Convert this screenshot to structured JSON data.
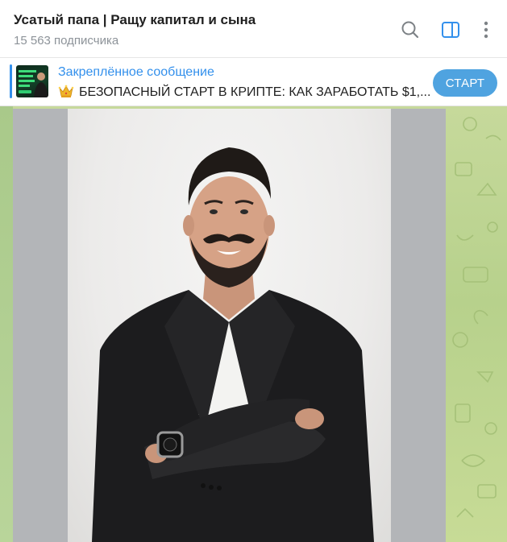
{
  "header": {
    "title": "Усатый папа | Ращу капитал и сына",
    "subscribers": "15 563 подписчика",
    "icons": [
      "search-icon",
      "sidebar-toggle-icon",
      "more-vertical-icon"
    ]
  },
  "pinned": {
    "label": "Закреплённое сообщение",
    "text": "БЕЗОПАСНЫЙ СТАРТ В КРИПТЕ: КАК ЗАРАБОТАТЬ $1,...",
    "emoji_icon": "crown-icon",
    "button_label": "СТАРТ"
  },
  "colors": {
    "accent": "#3390ec",
    "button": "#4fa3e0",
    "chat_background": "#b7d18c"
  },
  "message": {
    "media": "photo"
  }
}
